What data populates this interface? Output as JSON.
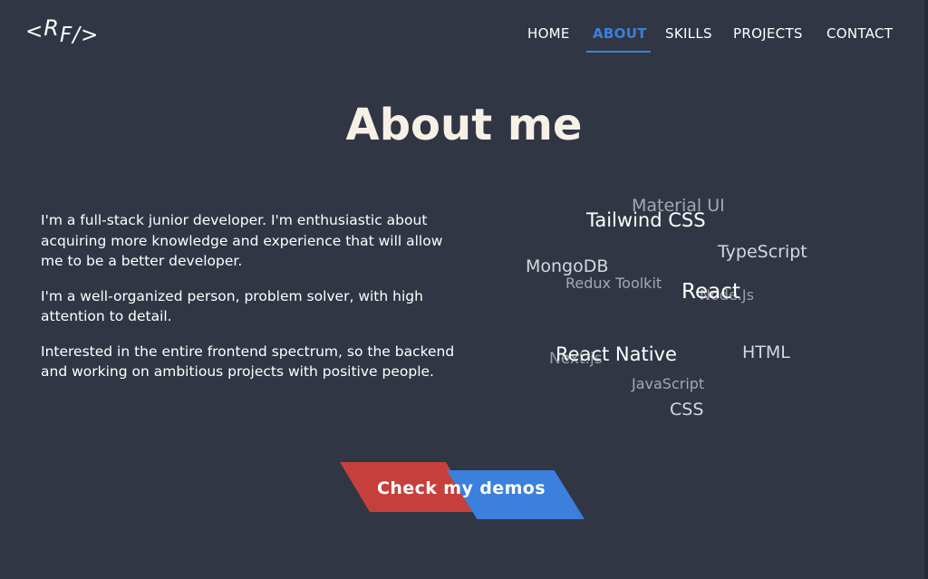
{
  "logo": {
    "prefix": "<",
    "r": "R",
    "rest": "F/>"
  },
  "nav": {
    "items": [
      {
        "label": "HOME"
      },
      {
        "label": "ABOUT"
      },
      {
        "label": "SKILLS"
      },
      {
        "label": "PROJECTS"
      },
      {
        "label": "CONTACT"
      }
    ],
    "active": "ABOUT",
    "accent_color": "#3a80dc"
  },
  "about": {
    "title": "About me",
    "paragraphs": [
      "I'm a full-stack junior developer. I'm enthusiastic about acquiring more knowledge and experience that will allow me to be a better developer.",
      "I'm a well-organized person, problem solver, with high attention to detail.",
      "Interested in the entire frontend spectrum, so the backend and working on ambitious projects with positive people."
    ]
  },
  "skills_cloud": {
    "words": [
      {
        "text": "Material UI"
      },
      {
        "text": "Tailwind CSS"
      },
      {
        "text": "TypeScript"
      },
      {
        "text": "MongoDB"
      },
      {
        "text": "Redux Toolkit"
      },
      {
        "text": "React"
      },
      {
        "text": "Node.Js"
      },
      {
        "text": "Next.js"
      },
      {
        "text": "React Native"
      },
      {
        "text": "HTML"
      },
      {
        "text": "JavaScript"
      },
      {
        "text": "CSS"
      }
    ]
  },
  "cta": {
    "label": "Check my demos",
    "colors": {
      "left": "#c6403b",
      "right": "#3a80dc"
    }
  },
  "colors": {
    "background": "#313644",
    "title": "#f7f0e6"
  }
}
